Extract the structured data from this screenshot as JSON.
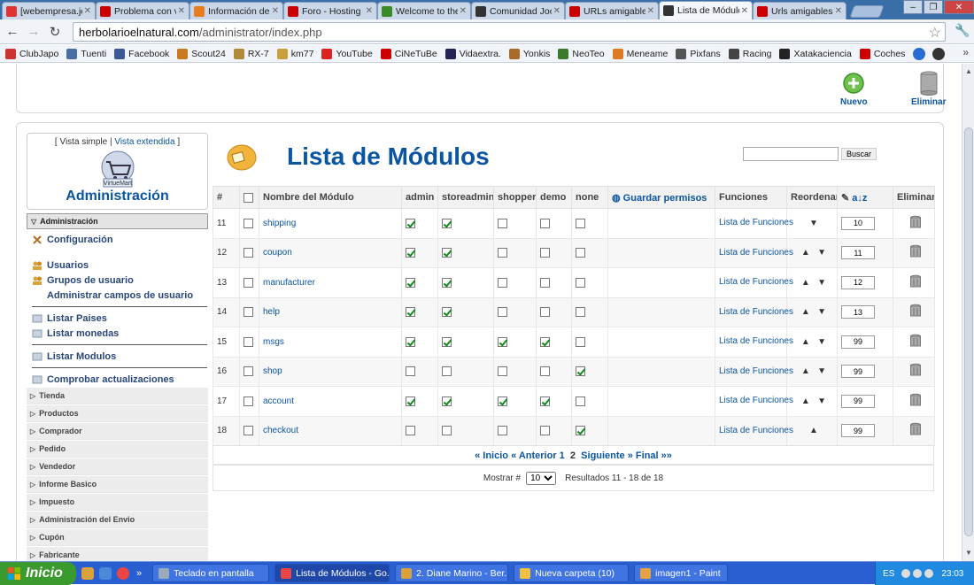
{
  "browser": {
    "tabs": [
      {
        "label": "[webempresa.jo",
        "color": "#d33"
      },
      {
        "label": "Problema con vi",
        "color": "#c00"
      },
      {
        "label": "Información de",
        "color": "#e87d20"
      },
      {
        "label": "Foro - Hosting",
        "color": "#c00"
      },
      {
        "label": "Welcome to the",
        "color": "#3a8a2a"
      },
      {
        "label": "Comunidad Joo",
        "color": "#333"
      },
      {
        "label": "URLs amigables",
        "color": "#c00"
      },
      {
        "label": "Lista de Módulo",
        "color": "#333"
      },
      {
        "label": "Urls amigables e",
        "color": "#c00"
      }
    ],
    "url_domain": "herbolarioelnatural.com",
    "url_path": "/administrator/index.php",
    "bookmarks": [
      {
        "label": "ClubJapo",
        "color": "#c33"
      },
      {
        "label": "Tuenti",
        "color": "#4a6fa5"
      },
      {
        "label": "Facebook",
        "color": "#3b5998"
      },
      {
        "label": "Scout24",
        "color": "#c87b1e"
      },
      {
        "label": "RX-7",
        "color": "#b08a3a"
      },
      {
        "label": "km77",
        "color": "#c9a13a"
      },
      {
        "label": "YouTube",
        "color": "#d22"
      },
      {
        "label": "CiNeTuBe",
        "color": "#c00"
      },
      {
        "label": "Vidaextra.",
        "color": "#225"
      },
      {
        "label": "Yonkis",
        "color": "#aa6a2a"
      },
      {
        "label": "NeoTeo",
        "color": "#3a7a2a"
      },
      {
        "label": "Meneame",
        "color": "#e07a20"
      },
      {
        "label": "Pixfans",
        "color": "#555"
      },
      {
        "label": "Racing",
        "color": "#444"
      },
      {
        "label": "Xatakaciencia",
        "color": "#222"
      },
      {
        "label": "Coches",
        "color": "#c00"
      }
    ]
  },
  "toolbar": {
    "new_label": "Nuevo",
    "delete_label": "Eliminar"
  },
  "sidebar": {
    "view_simple": "Vista simple",
    "view_extended": "Vista extendida",
    "logo_text": "VirtueMart",
    "admin_title": "Administración",
    "section_head": "Administración",
    "items": [
      {
        "label": "Configuración"
      },
      {
        "label": "Usuarios"
      },
      {
        "label": "Grupos de usuario"
      },
      {
        "label": "Administrar campos de usuario"
      },
      {
        "label": "Listar Paises"
      },
      {
        "label": "Listar monedas"
      },
      {
        "label": "Listar Modulos"
      },
      {
        "label": "Comprobar actualizaciones"
      }
    ],
    "sections": [
      "Tienda",
      "Productos",
      "Comprador",
      "Pedido",
      "Vendedor",
      "Informe Basico",
      "Impuesto",
      "Administración del Envio",
      "Cupón",
      "Fabricante"
    ]
  },
  "page": {
    "title": "Lista de Módulos",
    "search_button": "Buscar"
  },
  "table": {
    "headers": {
      "num": "#",
      "name": "Nombre del Módulo",
      "admin": "admin",
      "storeadmin": "storeadmin",
      "shopper": "shopper",
      "demo": "demo",
      "none": "none",
      "save": "Guardar permisos",
      "funcs": "Funciones",
      "reorder": "Reordenar",
      "delete": "Eliminar"
    },
    "func_link": "Lista de Funciones",
    "rows": [
      {
        "num": "11",
        "name": "shipping",
        "admin": true,
        "storeadmin": true,
        "shopper": false,
        "demo": false,
        "none": false,
        "up": false,
        "down": true,
        "order": "10"
      },
      {
        "num": "12",
        "name": "coupon",
        "admin": true,
        "storeadmin": true,
        "shopper": false,
        "demo": false,
        "none": false,
        "up": true,
        "down": true,
        "order": "11"
      },
      {
        "num": "13",
        "name": "manufacturer",
        "admin": true,
        "storeadmin": true,
        "shopper": false,
        "demo": false,
        "none": false,
        "up": true,
        "down": true,
        "order": "12"
      },
      {
        "num": "14",
        "name": "help",
        "admin": true,
        "storeadmin": true,
        "shopper": false,
        "demo": false,
        "none": false,
        "up": true,
        "down": true,
        "order": "13"
      },
      {
        "num": "15",
        "name": "msgs",
        "admin": true,
        "storeadmin": true,
        "shopper": true,
        "demo": true,
        "none": false,
        "up": true,
        "down": true,
        "order": "99"
      },
      {
        "num": "16",
        "name": "shop",
        "admin": false,
        "storeadmin": false,
        "shopper": false,
        "demo": false,
        "none": true,
        "up": true,
        "down": true,
        "order": "99"
      },
      {
        "num": "17",
        "name": "account",
        "admin": true,
        "storeadmin": true,
        "shopper": true,
        "demo": true,
        "none": false,
        "up": true,
        "down": true,
        "order": "99"
      },
      {
        "num": "18",
        "name": "checkout",
        "admin": false,
        "storeadmin": false,
        "shopper": false,
        "demo": false,
        "none": true,
        "up": true,
        "down": false,
        "order": "99"
      }
    ]
  },
  "pager": {
    "first": "« Inicio",
    "prev": "« Anterior",
    "p1": "1",
    "p2": "2",
    "next": "Siguiente »",
    "last": "Final »»"
  },
  "showbar": {
    "label": "Mostrar #",
    "value": "10",
    "results": "Resultados 11 - 18 de 18"
  },
  "taskbar": {
    "start": "Inicio",
    "tasks": [
      {
        "label": "Teclado en pantalla",
        "color": "#9ab"
      },
      {
        "label": "Lista de Módulos - Go...",
        "color": "#e44"
      },
      {
        "label": "2. Diane Marino - Ber...",
        "color": "#d9a23a"
      },
      {
        "label": "Nueva carpeta (10)",
        "color": "#f0c040"
      },
      {
        "label": "imagen1 - Paint",
        "color": "#e8a040"
      }
    ],
    "lang": "ES",
    "clock": "23:03"
  }
}
